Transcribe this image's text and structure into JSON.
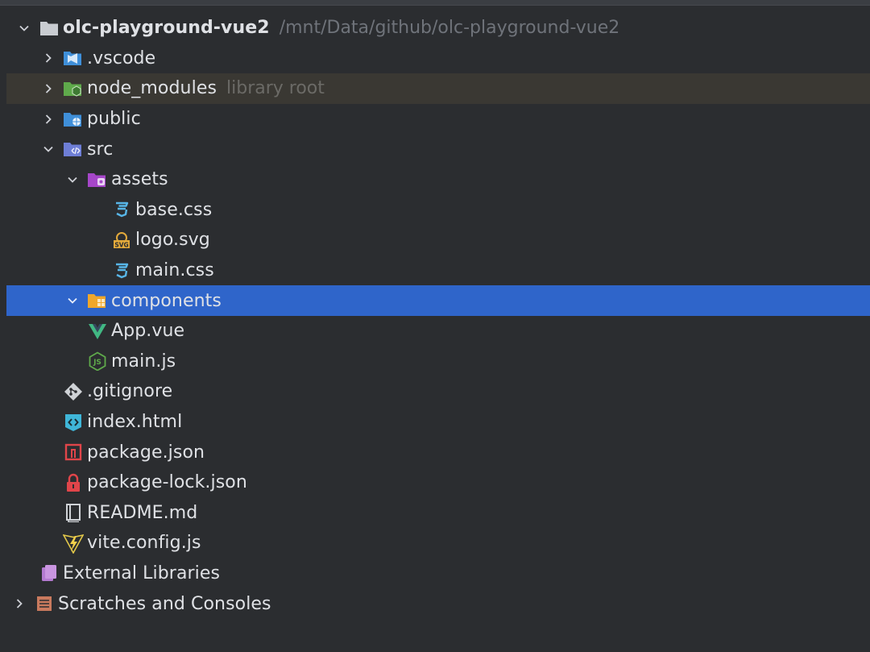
{
  "project": {
    "name": "olc-playground-vue2",
    "path": "/mnt/Data/github/olc-playground-vue2"
  },
  "items": {
    "vscode": ".vscode",
    "node_modules": "node_modules",
    "node_modules_hint": "library root",
    "public": "public",
    "src": "src",
    "assets": "assets",
    "base_css": "base.css",
    "logo_svg": "logo.svg",
    "main_css": "main.css",
    "components": "components",
    "app_vue": "App.vue",
    "main_js": "main.js",
    "gitignore": ".gitignore",
    "index_html": "index.html",
    "package_json": "package.json",
    "package_lock": "package-lock.json",
    "readme": "README.md",
    "vite_config": "vite.config.js",
    "external_libraries": "External Libraries",
    "scratches": "Scratches and Consoles"
  },
  "colors": {
    "background": "#2b2d30",
    "selection": "#2f65ca",
    "library_highlight": "#3a3833",
    "text": "#dfe1e5",
    "hint_text": "#6f737a"
  },
  "icons": {
    "folder": "folder-icon",
    "vscode_folder": "vscode-folder-icon",
    "node_folder": "node-folder-icon",
    "public_folder": "public-folder-icon",
    "src_folder": "src-folder-icon",
    "assets_folder": "assets-folder-icon",
    "components_folder": "components-folder-icon",
    "css_file": "css-file-icon",
    "svg_file": "svg-file-icon",
    "vue_file": "vue-file-icon",
    "nodejs_file": "nodejs-file-icon",
    "git_file": "git-file-icon",
    "html_file": "html-file-icon",
    "npm_file": "npm-file-icon",
    "lock_file": "lock-file-icon",
    "markdown_file": "markdown-file-icon",
    "vite_file": "vite-file-icon",
    "libraries": "libraries-icon",
    "scratches": "scratches-icon"
  }
}
